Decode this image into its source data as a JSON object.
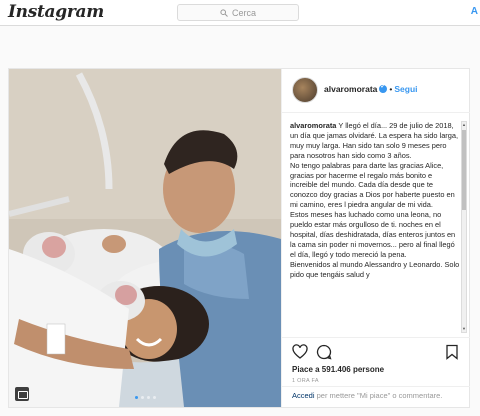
{
  "nav": {
    "logo": "Instagram",
    "search_placeholder": "Cerca",
    "right_link": "A"
  },
  "post": {
    "username": "alvaromorata",
    "separator": "•",
    "follow_label": "Segui",
    "caption_user": "alvaromorata",
    "caption_paragraphs": [
      "Y llegó el día... 29 de julio de 2018, un día que jamas olvidaré. La espera ha sido larga, muy muy larga. Han sido tan solo 9 meses pero para nosotros han sido como 3 años.",
      "No tengo palabras para darte las gracias Alice, gracias por hacerme el regalo más bonito e increible del mundo. Cada día desde que te conozco doy gracias a Dios por haberte puesto en mi camino, eres l piedra angular de mi vida.",
      "Estos meses has luchado como una leona, no pueldo estar más orgulloso de ti. noches en el hospital, días deshidratada, días enteros juntos en la cama sin poder ni movernos... pero al final llegó el día, llegó y todo mereció la pena.",
      "Bienvenidos al mundo Alessandro y Leonardo. Solo pido que tengáis salud y"
    ],
    "likes": "Piace a 591.406 persone",
    "time_ago": "1 ORA FA",
    "comment_prompt_link": "Accedi",
    "comment_prompt_text": " per mettere \"Mi piace\" o commentare.",
    "carousel": {
      "count": 4,
      "active_index": 0
    }
  },
  "colors": {
    "accent": "#3897f0",
    "border": "#dbdbdb",
    "link_dark": "#003569"
  },
  "icons": {
    "search": "search-icon",
    "like": "heart-icon",
    "comment": "comment-icon",
    "save": "bookmark-icon",
    "verified": "verified-badge-icon",
    "multi": "gallery-icon"
  }
}
